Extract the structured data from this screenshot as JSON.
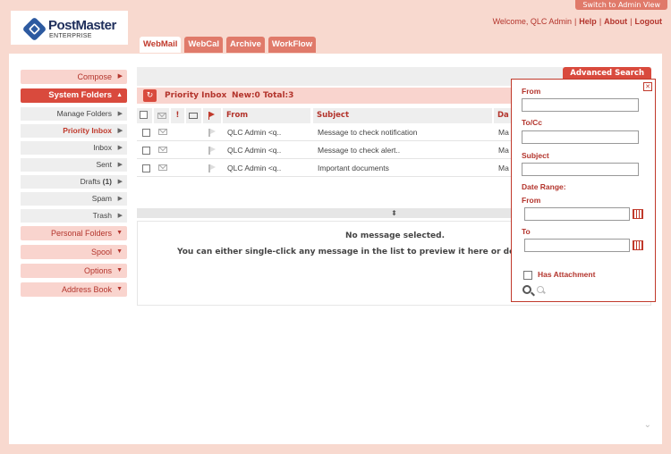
{
  "brand": {
    "name": "PostMaster",
    "edition": "ENTERPRISE"
  },
  "header": {
    "admin_view": "Switch to Admin View",
    "welcome": "Welcome, QLC Admin",
    "links": [
      "Help",
      "About",
      "Logout"
    ]
  },
  "tabs": [
    {
      "label": "WebMail",
      "active": true
    },
    {
      "label": "WebCal",
      "active": false
    },
    {
      "label": "Archive",
      "active": false
    },
    {
      "label": "WorkFlow",
      "active": false
    }
  ],
  "sidebar": {
    "compose": "Compose",
    "system_folders": "System Folders",
    "manage_folders": "Manage Folders",
    "priority_inbox": "Priority Inbox",
    "inbox": "Inbox",
    "sent": "Sent",
    "drafts": "Drafts",
    "drafts_count": "(1)",
    "spam": "Spam",
    "trash": "Trash",
    "personal_folders": "Personal Folders",
    "spool": "Spool",
    "options": "Options",
    "address_book": "Address Book"
  },
  "folder_bar": {
    "name": "Priority Inbox",
    "stats": "New:0 Total:3"
  },
  "table": {
    "headers": {
      "flag_important": "!",
      "from": "From",
      "subject": "Subject",
      "date": "Da"
    },
    "rows": [
      {
        "from": "QLC Admin <q..",
        "subject": "Message to check notification",
        "date": "Ma"
      },
      {
        "from": "QLC Admin <q..",
        "subject": "Message to check alert..",
        "date": "Ma"
      },
      {
        "from": "QLC Admin <q..",
        "subject": "Important documents",
        "date": "Ma"
      }
    ]
  },
  "preview": {
    "title": "No message selected.",
    "text": "You can either single-click any message in the list to preview it here or double-cli"
  },
  "advanced_search": {
    "button": "Advanced Search",
    "from": "From",
    "to_cc": "To/Cc",
    "subject": "Subject",
    "date_range": "Date Range:",
    "date_from": "From",
    "date_to": "To",
    "has_attachment": "Has Attachment"
  }
}
